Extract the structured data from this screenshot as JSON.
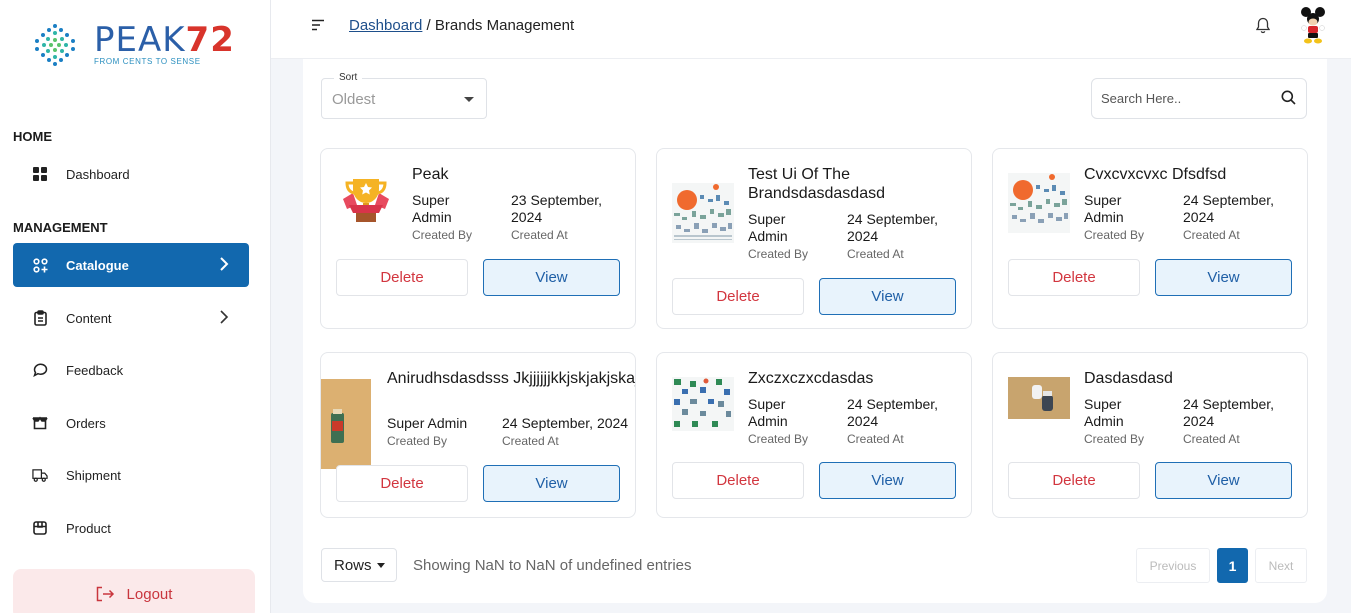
{
  "logo": {
    "word": "PEAK",
    "number": "72",
    "tagline": "FROM CENTS TO SENSE"
  },
  "sidebar": {
    "home_title": "HOME",
    "management_title": "MANAGEMENT",
    "items": [
      {
        "label": "Dashboard",
        "icon": "dashboard-grid-icon"
      },
      {
        "label": "Catalogue",
        "icon": "catalogue-icon",
        "active": true
      },
      {
        "label": "Content",
        "icon": "clipboard-icon"
      },
      {
        "label": "Feedback",
        "icon": "chat-bubble-icon"
      },
      {
        "label": "Orders",
        "icon": "box-open-icon"
      },
      {
        "label": "Shipment",
        "icon": "truck-icon"
      },
      {
        "label": "Product",
        "icon": "package-icon"
      }
    ],
    "logout_label": "Logout"
  },
  "header": {
    "breadcrumb_link": "Dashboard",
    "breadcrumb_separator": " / ",
    "breadcrumb_current": "Brands Management"
  },
  "toolbar": {
    "sort_label": "Sort",
    "sort_value": "Oldest",
    "search_placeholder": "Search Here.."
  },
  "cards": [
    {
      "name": "Peak",
      "created_by": "Super Admin",
      "created_at": "23 September, 2024",
      "created_by_label": "Created By",
      "created_at_label": "Created At",
      "delete_label": "Delete",
      "view_label": "View"
    },
    {
      "name": "Test Ui Of The Brandsdasdasdasd",
      "created_by": "Super Admin",
      "created_at": "24 September, 2024",
      "created_by_label": "Created By",
      "created_at_label": "Created At",
      "delete_label": "Delete",
      "view_label": "View"
    },
    {
      "name": "Cvxcvxcvxc Dfsdfsd",
      "created_by": "Super Admin",
      "created_at": "24 September, 2024",
      "created_by_label": "Created By",
      "created_at_label": "Created At",
      "delete_label": "Delete",
      "view_label": "View"
    },
    {
      "name": "Anirudhsdasdsss Jkjjjjjjkkjskjakjskajskjakjdddddd",
      "created_by": "Super Admin",
      "created_at": "24 September, 2024",
      "created_by_label": "Created By",
      "created_at_label": "Created At",
      "delete_label": "Delete",
      "view_label": "View"
    },
    {
      "name": "Zxczxczxcdasdas",
      "created_by": "Super Admin",
      "created_at": "24 September, 2024",
      "created_by_label": "Created By",
      "created_at_label": "Created At",
      "delete_label": "Delete",
      "view_label": "View"
    },
    {
      "name": "Dasdasdasd",
      "created_by": "Super Admin",
      "created_at": "24 September, 2024",
      "created_by_label": "Created By",
      "created_at_label": "Created At",
      "delete_label": "Delete",
      "view_label": "View"
    }
  ],
  "footer": {
    "rows_label": "Rows",
    "showing_text": "Showing NaN to NaN of undefined entries",
    "previous_label": "Previous",
    "current_page": "1",
    "next_label": "Next"
  },
  "colors": {
    "accent": "#1268ae",
    "delete": "#d2363f",
    "logout_bg": "#fbe9ea"
  }
}
